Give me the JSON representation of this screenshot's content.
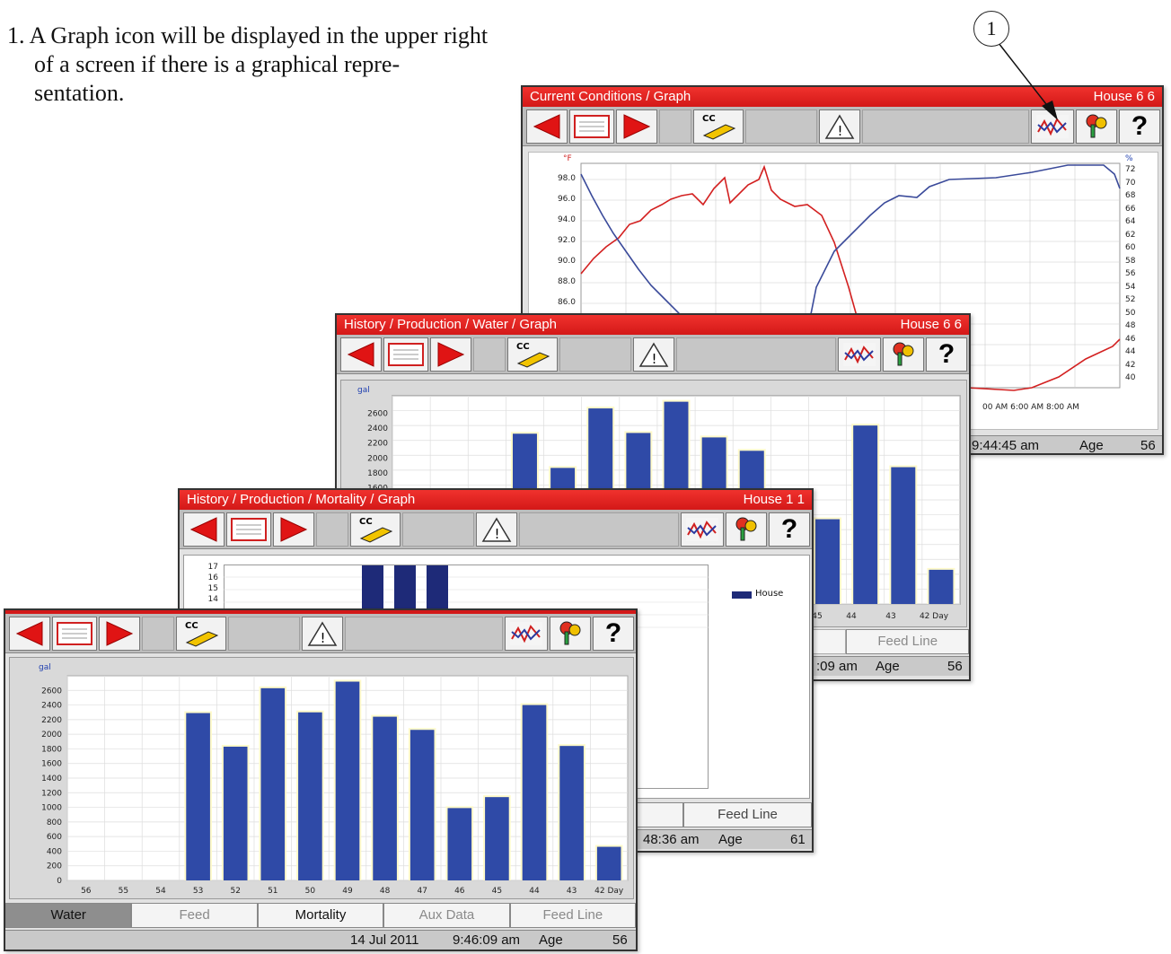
{
  "instruction": {
    "number": "1.",
    "line1": "A Graph icon will be displayed in the upper right",
    "line2": "of a screen if there is a graphical repre-",
    "line3": "sentation."
  },
  "callout": {
    "label": "1"
  },
  "icons": {
    "back": "left-arrow-icon",
    "list": "list-icon",
    "forward": "right-arrow-icon",
    "cc": "current-conditions-icon",
    "alarm": "warning-icon",
    "graph": "graph-icon",
    "keys": "keys-icon",
    "help": "help-icon"
  },
  "colors": {
    "title_red": "#e31b1b",
    "bar_blue": "#2f4aa7",
    "temp_line": "#d32020",
    "humidity_line": "#3a4a9a"
  },
  "screen_current": {
    "title": "Current Conditions / Graph",
    "house": "House 6 6",
    "help_glyph": "?",
    "unit_left": "°F",
    "unit_right": "%",
    "status_time": "9:44:45 am",
    "status_age_label": "Age",
    "status_age_value": "56",
    "x_labels_visible": "00 AM  6:00 AM  8:00 AM"
  },
  "screen_water_back": {
    "title": "History / Production / Water / Graph",
    "house": "House 6 6",
    "help_glyph": "?",
    "unit": "gal",
    "tab_visible": "Feed Line",
    "status_time": ":09 am",
    "status_age_label": "Age",
    "status_age_value": "56",
    "x_labels_visible": [
      "45",
      "44",
      "43",
      "42 Day"
    ]
  },
  "screen_mortality": {
    "title": "History / Production / Mortality / Graph",
    "house": "House 1 1",
    "help_glyph": "?",
    "legend_label": "House",
    "tab_left_partial": "ta",
    "tab_visible": "Feed Line",
    "status_time": "48:36 am",
    "status_age_label": "Age",
    "status_age_value": "61",
    "y_labels_visible": [
      "17",
      "16",
      "15",
      "14"
    ]
  },
  "screen_water_front": {
    "help_glyph": "?",
    "tabs": [
      "Water",
      "Feed",
      "Mortality",
      "Aux Data",
      "Feed Line"
    ],
    "status_date": "14 Jul 2011",
    "status_time": "9:46:09 am",
    "status_age_label": "Age",
    "status_age_value": "56"
  },
  "chart_data": [
    {
      "type": "line",
      "title": "",
      "x_tick_labels": [
        "00 AM",
        "6:00 AM",
        "8:00 AM"
      ],
      "y_left_label": "°F",
      "y_left_ticks": [
        98.0,
        96.0,
        94.0,
        92.0,
        90.0,
        88.0,
        86.0
      ],
      "y_right_label": "%",
      "y_right_ticks": [
        72,
        70,
        68,
        66,
        64,
        62,
        60,
        58,
        56,
        54,
        52,
        50,
        48,
        46,
        44,
        42,
        40
      ],
      "series": [
        {
          "values_temp_F": [
            89.0,
            91.5,
            93.0,
            94.5,
            95.5,
            97.0,
            95.5,
            97.5,
            98.3,
            95.5,
            94.5,
            90.0,
            85.0
          ]
        },
        {
          "values_humidity_pct": [
            70,
            62,
            58,
            54,
            50,
            46,
            52,
            58,
            64,
            68,
            70,
            72,
            72,
            70
          ]
        }
      ]
    },
    {
      "type": "bar",
      "title": "",
      "ylabel": "gal",
      "categories": [
        "56",
        "55",
        "54",
        "53",
        "52",
        "51",
        "50",
        "49",
        "48",
        "47",
        "46",
        "45",
        "44",
        "43",
        "42 Day"
      ],
      "values": [
        0,
        0,
        0,
        2290,
        1830,
        2630,
        2300,
        2720,
        2240,
        2060,
        990,
        1140,
        2400,
        1840,
        460
      ],
      "y_ticks": [
        0,
        200,
        400,
        600,
        800,
        1000,
        1200,
        1400,
        1600,
        1800,
        2000,
        2200,
        2400,
        2600
      ],
      "ylim": [
        0,
        2800
      ],
      "grid": true
    },
    {
      "type": "bar",
      "title": "",
      "y_ticks": [
        14,
        15,
        16,
        17
      ],
      "legend": [
        "House"
      ],
      "legend_placement": "right"
    }
  ]
}
